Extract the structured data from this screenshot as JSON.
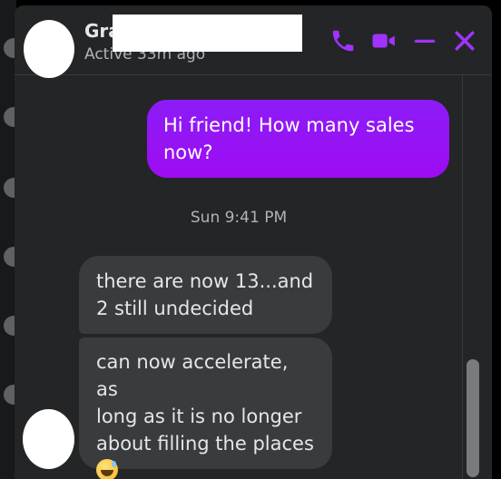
{
  "header": {
    "name": "Gra",
    "status": "Active 33m ago",
    "icons": [
      "phone-icon",
      "video-icon",
      "minimize-icon",
      "close-icon"
    ],
    "accent_color": "#a033ff"
  },
  "messages": [
    {
      "direction": "outgoing",
      "text": "Hi friend! How many sales\nnow?"
    },
    {
      "direction": "incoming",
      "text": "there are now 13...and\n2 still undecided"
    },
    {
      "direction": "incoming",
      "text": "can now accelerate, as\nlong as it is no longer\nabout filling the places\n",
      "emoji": "sweat-smile-emoji"
    }
  ],
  "timestamp": "Sun 9:41 PM"
}
